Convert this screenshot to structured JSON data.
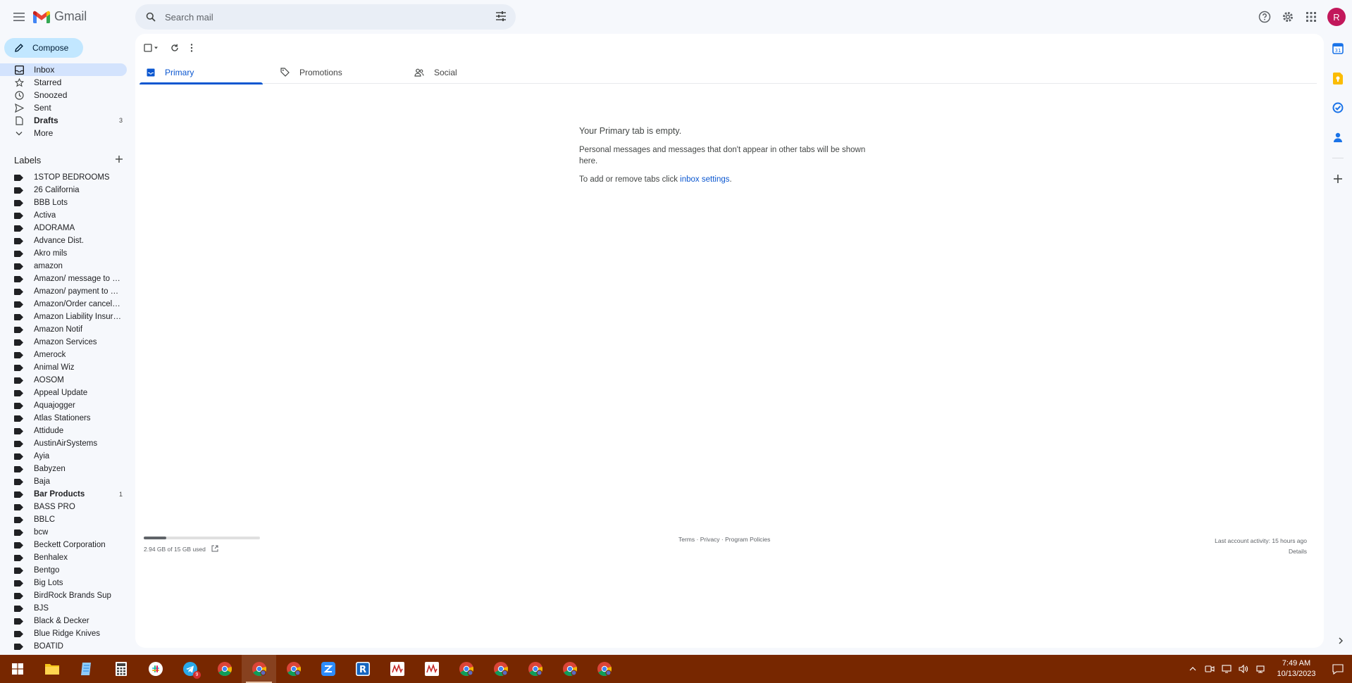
{
  "app": {
    "name": "Gmail",
    "accent": "#0b57d0",
    "compose_bg": "#c2e7ff",
    "active_nav_bg": "#d3e3fd",
    "avatar_color": "#c2185b",
    "taskbar_color": "#772700"
  },
  "header": {
    "search_placeholder": "Search mail",
    "avatar_letter": "R",
    "icons": [
      "menu-icon",
      "search-icon",
      "tune-icon",
      "help-icon",
      "settings-icon",
      "apps-grid-icon"
    ]
  },
  "sidebar": {
    "compose_label": "Compose",
    "nav": [
      {
        "label": "Inbox",
        "icon": "inbox-icon",
        "active": true,
        "count": ""
      },
      {
        "label": "Starred",
        "icon": "star-icon",
        "count": ""
      },
      {
        "label": "Snoozed",
        "icon": "clock-icon",
        "count": ""
      },
      {
        "label": "Sent",
        "icon": "send-icon",
        "count": ""
      },
      {
        "label": "Drafts",
        "icon": "draft-icon",
        "count": "3",
        "bold": true
      },
      {
        "label": "More",
        "icon": "chevron-down-icon",
        "count": ""
      }
    ],
    "labels_title": "Labels",
    "labels": [
      {
        "label": "1STOP BEDROOMS"
      },
      {
        "label": "26 California"
      },
      {
        "label": "BBB Lots"
      },
      {
        "label": "Activa"
      },
      {
        "label": "ADORAMA"
      },
      {
        "label": "Advance Dist."
      },
      {
        "label": "Akro mils"
      },
      {
        "label": "amazon"
      },
      {
        "label": "Amazon/ message to b..."
      },
      {
        "label": "Amazon/ payment to cli..."
      },
      {
        "label": "Amazon/Order cancella..."
      },
      {
        "label": "Amazon Liability Insura..."
      },
      {
        "label": "Amazon Notif"
      },
      {
        "label": "Amazon Services"
      },
      {
        "label": "Amerock"
      },
      {
        "label": "Animal Wiz"
      },
      {
        "label": "AOSOM"
      },
      {
        "label": "Appeal Update"
      },
      {
        "label": "Aquajogger"
      },
      {
        "label": "Atlas Stationers"
      },
      {
        "label": "Attidude"
      },
      {
        "label": "AustinAirSystems"
      },
      {
        "label": "Ayia"
      },
      {
        "label": "Babyzen"
      },
      {
        "label": "Baja"
      },
      {
        "label": "Bar Products",
        "bold": true,
        "count": "1"
      },
      {
        "label": "BASS PRO"
      },
      {
        "label": "BBLC"
      },
      {
        "label": "bcw"
      },
      {
        "label": "Beckett Corporation"
      },
      {
        "label": "Benhalex"
      },
      {
        "label": "Bentgo"
      },
      {
        "label": "Big Lots"
      },
      {
        "label": "BirdRock Brands Sup"
      },
      {
        "label": "BJS"
      },
      {
        "label": "Black & Decker"
      },
      {
        "label": "Blue Ridge Knives"
      },
      {
        "label": "BOATID"
      }
    ]
  },
  "main": {
    "tabs": [
      {
        "label": "Primary",
        "icon": "inbox-icon",
        "active": true
      },
      {
        "label": "Promotions",
        "icon": "tag-icon"
      },
      {
        "label": "Social",
        "icon": "people-icon"
      }
    ],
    "empty_title": "Your Primary tab is empty.",
    "empty_body": "Personal messages and messages that don't appear in other tabs will be shown here.",
    "empty_hint_prefix": "To add or remove tabs click ",
    "empty_hint_link": "inbox settings",
    "empty_hint_suffix": "."
  },
  "footer": {
    "storage_text": "2.94 GB of 15 GB used",
    "storage_used_fraction": 0.196,
    "links": "Terms · Privacy · Program Policies",
    "last_activity": "Last account activity: 15 hours ago",
    "details": "Details"
  },
  "side_panel": {
    "icons": [
      "calendar-icon",
      "keep-icon",
      "tasks-icon",
      "contacts-icon",
      "add-icon"
    ]
  },
  "taskbar": {
    "apps": [
      {
        "icon": "windows-start-icon"
      },
      {
        "icon": "file-explorer-icon"
      },
      {
        "icon": "notepad-icon"
      },
      {
        "icon": "calculator-icon"
      },
      {
        "icon": "slack-icon"
      },
      {
        "icon": "telegram-icon",
        "badge": "9"
      },
      {
        "icon": "chrome-icon"
      },
      {
        "icon": "chrome-profile-icon",
        "active": true
      },
      {
        "icon": "chrome-profile-icon"
      },
      {
        "icon": "zoom-icon"
      },
      {
        "icon": "r-app-icon"
      },
      {
        "icon": "chart-app-icon"
      },
      {
        "icon": "chart-app-icon"
      },
      {
        "icon": "chrome-profile-icon"
      },
      {
        "icon": "chrome-profile-icon"
      },
      {
        "icon": "chrome-profile-icon"
      },
      {
        "icon": "chrome-profile-icon"
      },
      {
        "icon": "chrome-profile-icon"
      }
    ],
    "time": "7:49 AM",
    "date": "10/13/2023"
  }
}
